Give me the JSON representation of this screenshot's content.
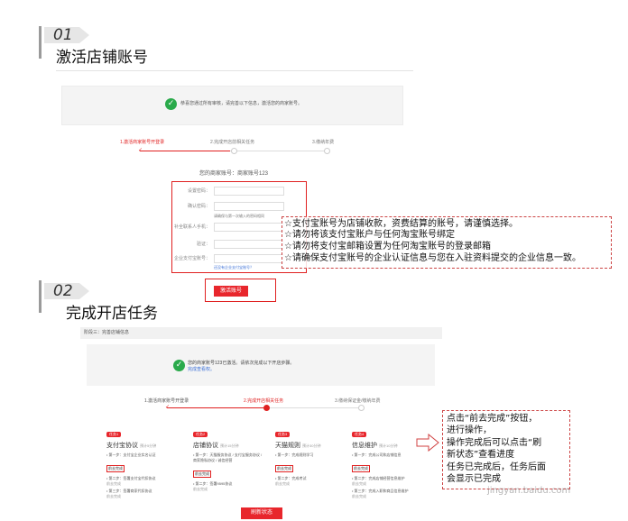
{
  "step1": {
    "number": "01",
    "title": "激活店铺账号",
    "notice": "恭喜您通过所有审核，请完善以下信息，激活您的商家账号。",
    "progress_steps": [
      "1.激活商家账号开登录",
      "2.完成开店前相关任务",
      "3.缴纳年费"
    ],
    "account_label": "您的商家账号：商家账号123",
    "fields": [
      {
        "label": "设置密码：",
        "hint": ""
      },
      {
        "label": "确认密码：",
        "hint": "请确保与第一次输入的密码相同"
      },
      {
        "label": "补全联系人手机：",
        "hint": ""
      },
      {
        "label": "验证：",
        "hint": ""
      },
      {
        "label": "企业支付宝账号：",
        "hint": ""
      }
    ],
    "alipay_link": "还没有企业支付宝账号？",
    "activate_button": "激活账号",
    "tips": [
      "☆支付宝账号为店铺收款，资费结算的账号，请谨慎选择。",
      "☆请勿将该支付宝账户与任何淘宝账号绑定",
      "☆请勿将支付宝邮箱设置为任何淘宝账号的登录邮箱",
      "☆请确保支付宝账号的企业认证信息与您在入驻资料提交的企业信息一致。"
    ]
  },
  "step2": {
    "number": "02",
    "title": "完成开店任务",
    "stage_header": "阶段三：完善店铺信息",
    "notice_line1": "您的商家账号123已激活。请依次完成以下开店步骤。",
    "notice_line2": "完成查看权。",
    "progress_steps": [
      "1.激活商家账号开登录",
      "2.完成开店相关任务",
      "3.缴纳保证金/缴纳年费"
    ],
    "tasks": [
      {
        "badge": "任务1",
        "name": "支付宝协议",
        "time": "预计5分钟",
        "steps": [
          {
            "text": "• 第一步：支付宝企业实名认证",
            "status": "前去完成",
            "linked": true
          },
          {
            "text": "• 第二步：签署支付宝代扣协议",
            "status": "前去完成",
            "linked": false
          },
          {
            "text": "• 第三步：签署商家代扣协议",
            "status": "前去完成",
            "linked": false
          }
        ]
      },
      {
        "badge": "任务2",
        "name": "店铺协议",
        "time": "预计15分钟",
        "steps": [
          {
            "text": "• 第一步：天猫服务协议 / 支付宝服务协议 / 商家隐私协议 / 诚信经营",
            "status": "前去完成",
            "linked": true
          },
          {
            "text": "• 第二步：签署9595协议",
            "status": "前去完成",
            "linked": false
          }
        ]
      },
      {
        "badge": "任务3",
        "name": "天猫规则",
        "time": "预计30分钟",
        "steps": [
          {
            "text": "• 第一步：完成规则学习",
            "status": "前去完成",
            "linked": true
          },
          {
            "text": "• 第二步：完成考试",
            "status": "前去完成",
            "linked": false
          }
        ]
      },
      {
        "badge": "任务4",
        "name": "信息维护",
        "time": "预计10分钟",
        "steps": [
          {
            "text": "• 第一步：完成公司和店铺信息",
            "status": "前去完成",
            "linked": true
          },
          {
            "text": "• 第二步：完成店铺经营信息维护",
            "status": "前去完成",
            "linked": false
          },
          {
            "text": "• 第三步：完成入职和商品信息维护",
            "status": "前去完成",
            "linked": false
          }
        ]
      }
    ],
    "refresh_button": "刷新状态",
    "tip_lines": [
      "点击“前去完成”按钮，",
      "进行操作，",
      "操作完成后可以点击“刷",
      "新状态”查看进度",
      "任务已完成后，任务后面",
      "会显示已完成"
    ]
  },
  "watermark": "jingyan.baidu.com"
}
